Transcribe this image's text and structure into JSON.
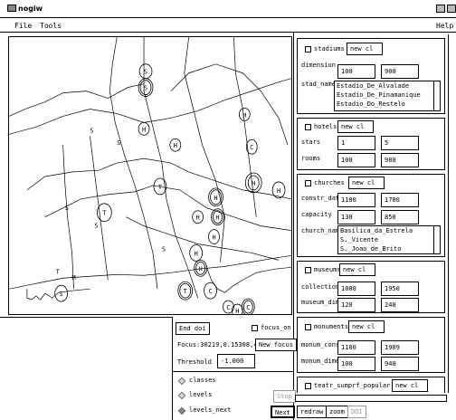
{
  "window": {
    "title": "nogiw"
  },
  "menu": {
    "file": "File",
    "tools": "Tools",
    "help": "Help"
  },
  "controls": {
    "end_doi": "End doi",
    "focus_on": "focus_on",
    "focus_label": "Focus:30219,0.15308,4",
    "new_focus": "New focus",
    "threshold_label": "Threshold",
    "threshold_value": "-1.000",
    "radios": [
      "classes",
      "levels",
      "levels_next"
    ],
    "stop": "Stop",
    "next": "Next",
    "redraw": "redraw",
    "zoom": "zoom",
    "doi": "DOI"
  },
  "panels": {
    "stadiums": {
      "name": "stadiums",
      "new_cl": "new cl",
      "dim_label": "dimension",
      "dim_min": "100",
      "dim_max": "900",
      "list_label": "stad_name",
      "list": [
        "Estadio_De_Alvalade",
        "Estadio_De_Pinamanique",
        "Estadio_Do_Restelo"
      ]
    },
    "hotels": {
      "name": "hotels",
      "new_cl": "new cl",
      "stars_label": "stars",
      "stars_min": "1",
      "stars_max": "5",
      "rooms_label": "rooms",
      "rooms_min": "100",
      "rooms_max": "980"
    },
    "churches": {
      "name": "churches",
      "new_cl": "new cl",
      "c1_label": "constr_date",
      "c1_min": "1100",
      "c1_max": "1700",
      "c2_label": "capacity",
      "c2_min": "130",
      "c2_max": "850",
      "list_label": "church_name",
      "list": [
        "Basilica_da_Estrela",
        "S._Vicente",
        "S._Joao_de_Brito"
      ]
    },
    "museums": {
      "name": "museums",
      "new_cl": "new cl",
      "c1_label": "collection",
      "c1_min": "1000",
      "c1_max": "1950",
      "c2_label": "museum_dim",
      "c2_min": "120",
      "c2_max": "240"
    },
    "monuments": {
      "name": "monuments",
      "new_cl": "new cl",
      "c1_label": "monum_const",
      "c1_min": "1100",
      "c1_max": "1909",
      "c2_label": "monum_dimer",
      "c2_min": "100",
      "c2_max": "940"
    },
    "partial": {
      "name": "teatr_sumprf_popular",
      "new_cl": "new cl"
    }
  },
  "map": {
    "markers": [
      {
        "l": "S"
      },
      {
        "l": "S"
      },
      {
        "l": "H"
      },
      {
        "l": "H"
      },
      {
        "l": "T"
      },
      {
        "l": "H"
      },
      {
        "l": "H"
      },
      {
        "l": "H"
      },
      {
        "l": "H"
      },
      {
        "l": "H"
      },
      {
        "l": "H"
      },
      {
        "l": "T"
      },
      {
        "l": "C"
      },
      {
        "l": "H"
      },
      {
        "l": "S"
      },
      {
        "l": "T"
      },
      {
        "l": "H"
      },
      {
        "l": "C"
      },
      {
        "l": "H"
      },
      {
        "l": "C"
      },
      {
        "l": "C"
      },
      {
        "l": "H"
      }
    ],
    "labels": [
      "S",
      "S",
      "S",
      "S",
      "S",
      "T",
      "M"
    ]
  }
}
